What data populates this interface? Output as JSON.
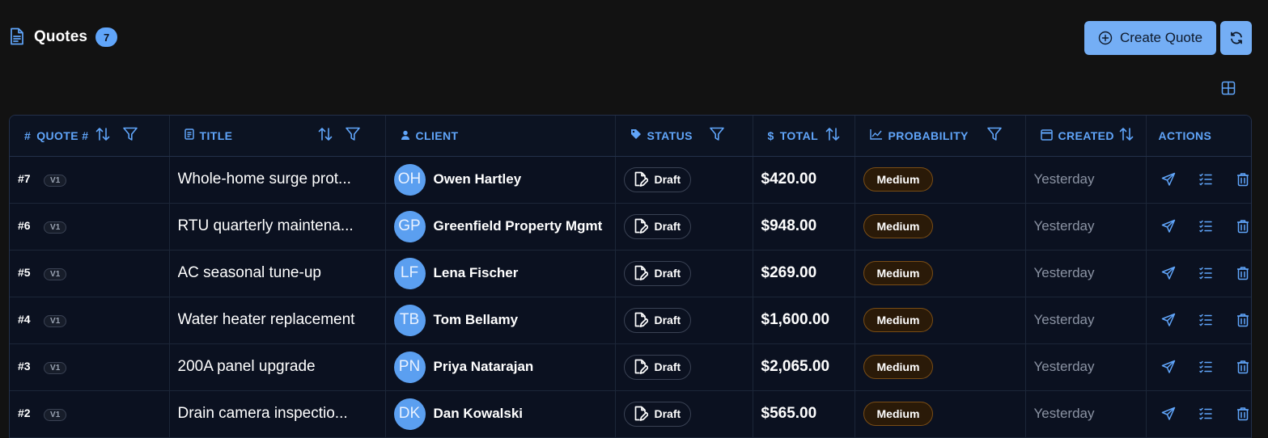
{
  "header": {
    "title": "Quotes",
    "count": "7",
    "create_label": "Create Quote",
    "icons": [
      "document-icon",
      "plus-circle-icon",
      "refresh-icon",
      "grid-toggle-icon"
    ]
  },
  "colors": {
    "accent": "#60a5fa",
    "button": "#74aef5",
    "background": "#121212",
    "table_bg": "#0b1120",
    "medium_border": "#7a4d15"
  },
  "columns": [
    {
      "prefix": "#",
      "label": "QUOTE #"
    },
    {
      "label": "TITLE"
    },
    {
      "label": "CLIENT"
    },
    {
      "label": "STATUS"
    },
    {
      "prefix": "$",
      "label": "TOTAL"
    },
    {
      "label": "PROBABILITY"
    },
    {
      "label": "CREATED"
    },
    {
      "label": "ACTIONS"
    }
  ],
  "rows": [
    {
      "num": "#7",
      "ver": "V1",
      "title": "Whole-home surge prot...",
      "initials": "OH",
      "client": "Owen Hartley",
      "status": "Draft",
      "total": "$420.00",
      "probability": "Medium",
      "created": "Yesterday"
    },
    {
      "num": "#6",
      "ver": "V1",
      "title": "RTU quarterly maintena...",
      "initials": "GP",
      "client": "Greenfield Property Mgmt",
      "status": "Draft",
      "total": "$948.00",
      "probability": "Medium",
      "created": "Yesterday"
    },
    {
      "num": "#5",
      "ver": "V1",
      "title": "AC seasonal tune-up",
      "initials": "LF",
      "client": "Lena Fischer",
      "status": "Draft",
      "total": "$269.00",
      "probability": "Medium",
      "created": "Yesterday"
    },
    {
      "num": "#4",
      "ver": "V1",
      "title": "Water heater replacement",
      "initials": "TB",
      "client": "Tom Bellamy",
      "status": "Draft",
      "total": "$1,600.00",
      "probability": "Medium",
      "created": "Yesterday"
    },
    {
      "num": "#3",
      "ver": "V1",
      "title": "200A panel upgrade",
      "initials": "PN",
      "client": "Priya Natarajan",
      "status": "Draft",
      "total": "$2,065.00",
      "probability": "Medium",
      "created": "Yesterday"
    },
    {
      "num": "#2",
      "ver": "V1",
      "title": "Drain camera inspectio...",
      "initials": "DK",
      "client": "Dan Kowalski",
      "status": "Draft",
      "total": "$565.00",
      "probability": "Medium",
      "created": "Yesterday"
    }
  ]
}
